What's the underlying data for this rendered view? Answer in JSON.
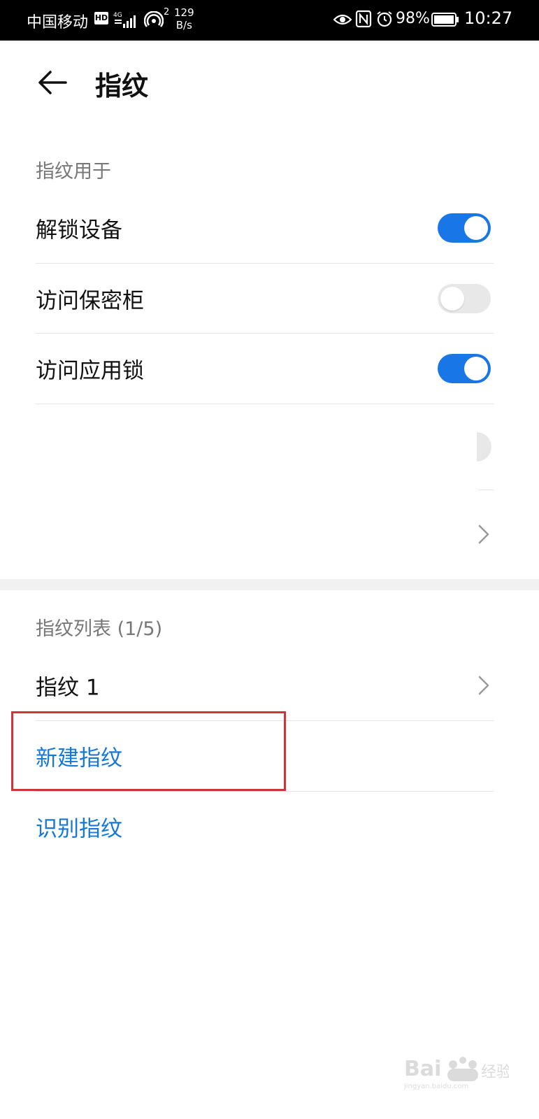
{
  "status_bar": {
    "carrier": "中国移动",
    "hd_badge": "HD",
    "network": "4G",
    "hotspot_count": "2",
    "speed_value": "129",
    "speed_unit": "B/s",
    "battery": "98%",
    "time": "10:27",
    "icons": [
      "signal-icon",
      "hotspot-icon",
      "eye-comfort-icon",
      "nfc-icon",
      "alarm-icon",
      "battery-icon"
    ]
  },
  "header": {
    "title": "指纹",
    "back_icon": "arrow-left-icon"
  },
  "usage_section": {
    "label": "指纹用于",
    "items": [
      {
        "label": "解锁设备",
        "toggle": "on"
      },
      {
        "label": "访问保密柜",
        "toggle": "off"
      },
      {
        "label": "访问应用锁",
        "toggle": "on"
      }
    ]
  },
  "fingerprint_list": {
    "label": "指纹列表 (1/5)",
    "items": [
      {
        "label": "指纹 1"
      }
    ],
    "new_fingerprint": "新建指纹",
    "identify_fingerprint": "识别指纹"
  },
  "colors": {
    "accent": "#1976e6",
    "link": "#1578d8",
    "highlight": "#d0343a",
    "toggle_off": "#e8e8e8"
  },
  "watermark": {
    "text": "Baidu 经验",
    "subtext": "jingyan.baidu.com"
  }
}
